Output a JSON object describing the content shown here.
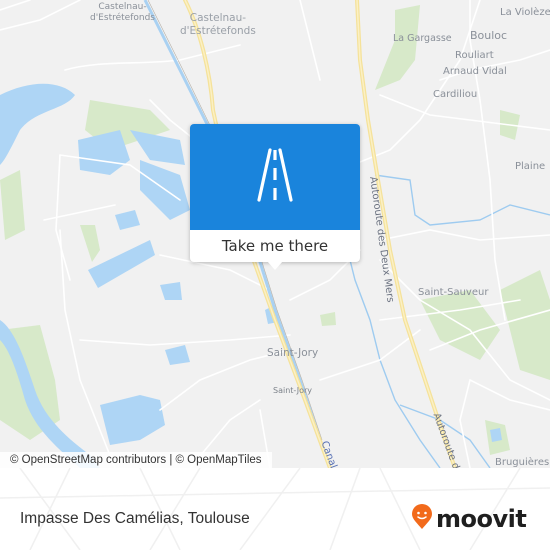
{
  "map": {
    "place_labels": [
      {
        "id": "castelnau-large",
        "text": "Castelnau-\nd'Estrétefonds"
      },
      {
        "id": "castelnau-small",
        "text": "Castelnau-\nd'Estrétefonds"
      },
      {
        "id": "la-violeze",
        "text": "La Violèze"
      },
      {
        "id": "la-gargasse",
        "text": "La Gargasse"
      },
      {
        "id": "bouloc",
        "text": "Bouloc"
      },
      {
        "id": "rouliart",
        "text": "Rouliart"
      },
      {
        "id": "arnaud-vidal",
        "text": "Arnaud Vidal"
      },
      {
        "id": "cardiliou",
        "text": "Cardiliou"
      },
      {
        "id": "plaine",
        "text": "Plaine"
      },
      {
        "id": "saint-sauveur",
        "text": "Saint-Sauveur"
      },
      {
        "id": "saint-jory-large",
        "text": "Saint-Jory"
      },
      {
        "id": "saint-jory-small",
        "text": "Saint-Jory"
      },
      {
        "id": "bruguieres",
        "text": "Bruguières"
      }
    ],
    "road_labels": {
      "autoroute_1": "Autoroute des Deux Mers",
      "autoroute_2": "Autoroute des D",
      "canal": "Canal Lat"
    },
    "colors": {
      "background": "#f1f1f1",
      "water": "#a9d3f5",
      "park": "#d2e6c4",
      "motorway": "#f7e7a1",
      "road": "#ffffff"
    }
  },
  "popup": {
    "icon": "road-icon",
    "action_label": "Take me there",
    "accent_color": "#1a84dc"
  },
  "attribution": "© OpenStreetMap contributors | © OpenMapTiles",
  "footer": {
    "address": "Impasse Des Camélias, Toulouse",
    "brand": "moovit",
    "brand_color": "#f26a1b"
  }
}
